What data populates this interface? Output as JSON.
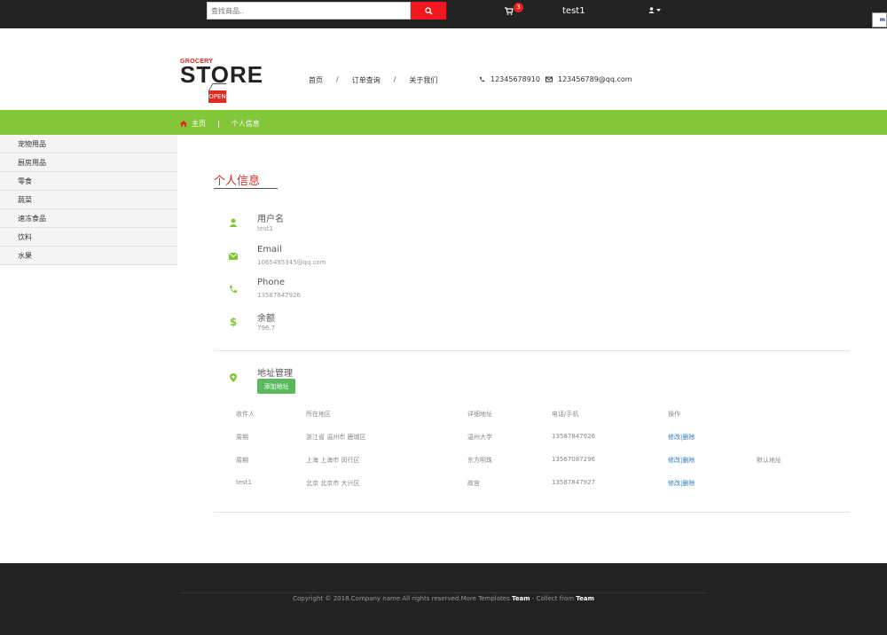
{
  "topbar": {
    "search_placeholder": "查找商品..",
    "cart_count": "3",
    "username": "test1"
  },
  "logo": {
    "top_text": "GROCERY",
    "main_text": "STORE",
    "sign_text": "OPEN"
  },
  "nav": {
    "items": [
      "首页",
      "订单查询",
      "关于我们"
    ],
    "separator": "/",
    "phone": "12345678910",
    "email": "123456789@qq.com"
  },
  "breadcrumb": {
    "home": "主页",
    "separator": "|",
    "current": "个人信息"
  },
  "sidebar": {
    "items": [
      "宠物用品",
      "厨房用品",
      "零食",
      "蔬菜",
      "速冻食品",
      "饮料",
      "水果"
    ]
  },
  "profile": {
    "title": "个人信息",
    "fields": [
      {
        "label": "用户名",
        "value": "test1",
        "icon": "user-icon"
      },
      {
        "label": "Email",
        "value": "1065495345@qq.com",
        "icon": "envelope-icon"
      },
      {
        "label": "Phone",
        "value": "13587847926",
        "icon": "phone-icon"
      },
      {
        "label": "余额",
        "value": "796.7",
        "icon": "dollar-icon"
      }
    ]
  },
  "address": {
    "title": "地址管理",
    "add_button": "添加地址",
    "headers": [
      "收件人",
      "所在地区",
      "详细地址",
      "电话/手机",
      "操作"
    ],
    "rows": [
      {
        "name": "周期",
        "region": "浙江省 温州市 鹿城区",
        "detail": "温州大学",
        "phone": "13587847926",
        "action": "修改|删除",
        "default": ""
      },
      {
        "name": "周期",
        "region": "上海 上海市 闵行区",
        "detail": "东方明珠",
        "phone": "13567087296",
        "action": "修改|删除",
        "default": "默认地址"
      },
      {
        "name": "test1",
        "region": "北京 北京市 大兴区",
        "detail": "故宫",
        "phone": "13587847927",
        "action": "修改|删除",
        "default": ""
      }
    ]
  },
  "footer": {
    "text_prefix": "Copyright © 2018.Company name All rights reserved.More Templates ",
    "team1": "Team",
    "text_mid": " - Collect from ",
    "team2": "Team"
  },
  "colors": {
    "accent_green": "#84c639",
    "accent_red": "#e02b1f",
    "dark": "#222222"
  }
}
